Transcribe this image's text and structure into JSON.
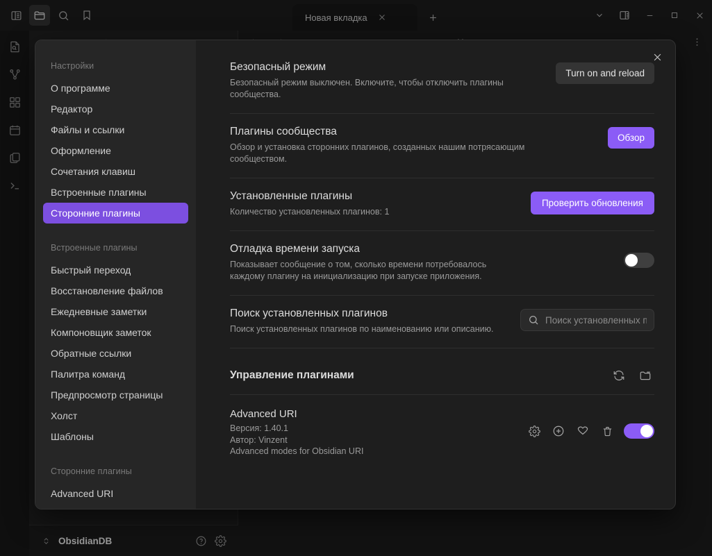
{
  "window": {
    "tab_label": "Новая вкладка",
    "view_title": "Новая вкладка",
    "controls": {
      "dropdown": "chevron-down-icon",
      "right_sidebar": "right-sidebar-toggle-icon",
      "minimize": "minimize-icon",
      "maximize": "maximize-icon",
      "close": "close-icon"
    },
    "left_icons": [
      {
        "name": "sidebar-toggle-icon",
        "active": false
      },
      {
        "name": "folder-icon",
        "active": true
      },
      {
        "name": "search-icon",
        "active": false
      },
      {
        "name": "bookmark-icon",
        "active": false
      }
    ]
  },
  "rail": {
    "items": [
      "file-search-icon",
      "graph-view-icon",
      "blocks-icon",
      "calendar-icon",
      "copy-files-icon",
      "terminal-icon"
    ]
  },
  "explorer": {
    "header_icons": [
      "new-note-icon",
      "new-folder-icon",
      "sort-icon",
      "collapse-icon"
    ]
  },
  "statusbar": {
    "vault_name": "ObsidianDB",
    "help_icon": "help-circle-icon",
    "settings_icon": "gear-icon"
  },
  "settings_modal": {
    "close_label": "×",
    "sidebar": {
      "groups": [
        {
          "title": "Настройки",
          "items": [
            {
              "label": "О программе",
              "selected": false
            },
            {
              "label": "Редактор",
              "selected": false
            },
            {
              "label": "Файлы и ссылки",
              "selected": false
            },
            {
              "label": "Оформление",
              "selected": false
            },
            {
              "label": "Сочетания клавиш",
              "selected": false
            },
            {
              "label": "Встроенные плагины",
              "selected": false
            },
            {
              "label": "Сторонние плагины",
              "selected": true
            }
          ]
        },
        {
          "title": "Встроенные плагины",
          "items": [
            {
              "label": "Быстрый переход",
              "selected": false
            },
            {
              "label": "Восстановление файлов",
              "selected": false
            },
            {
              "label": "Ежедневные заметки",
              "selected": false
            },
            {
              "label": "Компоновщик заметок",
              "selected": false
            },
            {
              "label": "Обратные ссылки",
              "selected": false
            },
            {
              "label": "Палитра команд",
              "selected": false
            },
            {
              "label": "Предпросмотр страницы",
              "selected": false
            },
            {
              "label": "Холст",
              "selected": false
            },
            {
              "label": "Шаблоны",
              "selected": false
            }
          ]
        },
        {
          "title": "Сторонние плагины",
          "items": [
            {
              "label": "Advanced URI",
              "selected": false
            }
          ]
        }
      ]
    },
    "settings": [
      {
        "name": "Безопасный режим",
        "desc": "Безопасный режим выключен. Включите, чтобы отключить плагины сообщества.",
        "control": "button",
        "button_label": "Turn on and reload",
        "accent": false
      },
      {
        "name": "Плагины сообщества",
        "desc": "Обзор и установка сторонних плагинов, созданных нашим потрясающим сообществом.",
        "control": "button",
        "button_label": "Обзор",
        "accent": true
      },
      {
        "name": "Установленные плагины",
        "desc": "Количество установленных плагинов: 1",
        "control": "button",
        "button_label": "Проверить обновления",
        "accent": true
      },
      {
        "name": "Отладка времени запуска",
        "desc": "Показывает сообщение о том, сколько времени потребовалось каждому плагину на инициализацию при запуске приложения.",
        "control": "toggle",
        "toggle_on": false
      },
      {
        "name": "Поиск установленных плагинов",
        "desc": "Поиск установленных плагинов по наименованию или описанию.",
        "control": "search",
        "search_value": "",
        "search_placeholder": "Поиск установленных пл"
      }
    ],
    "management": {
      "title": "Управление плагинами",
      "action_icons": [
        "refresh-icon",
        "open-folder-icon"
      ],
      "plugins": [
        {
          "name": "Advanced URI",
          "version_line": "Версия: 1.40.1",
          "author_line": "Автор: Vinzent",
          "description": "Advanced modes for Obsidian URI",
          "enabled": true,
          "action_icons": [
            "gear-icon",
            "plus-circle-icon",
            "heart-icon",
            "trash-icon"
          ]
        }
      ]
    }
  },
  "colors": {
    "accent": "#8b5cf6",
    "selected_sidebar": "#7c4fe0",
    "modal_bg": "#1e1e1e",
    "sidebar_bg": "#262626",
    "toggle_off": "#3f3f3f"
  }
}
